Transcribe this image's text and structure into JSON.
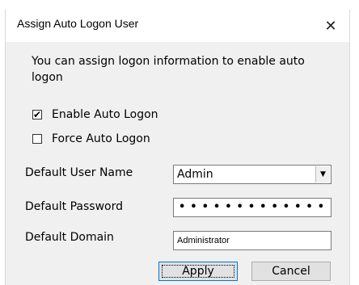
{
  "window": {
    "title": "Assign Auto Logon User",
    "close_glyph": "✕"
  },
  "instructions": "You can assign  logon information to enable auto logon",
  "checkboxes": [
    {
      "label": "Enable Auto Logon",
      "checked": true,
      "mark": "✔"
    },
    {
      "label": "Force Auto Logon",
      "checked": false,
      "mark": ""
    }
  ],
  "fields": {
    "username": {
      "label": "Default User Name",
      "value": "Admin",
      "dropdown_glyph": "▼"
    },
    "password": {
      "label": "Default Password",
      "masked": "•••••••••••••"
    },
    "domain": {
      "label": "Default Domain",
      "value": "Administrator"
    }
  },
  "buttons": {
    "apply": "Apply",
    "cancel": "Cancel"
  },
  "colors": {
    "dialog_background": "#f0f0f0",
    "default_button_border": "#0078d7"
  }
}
